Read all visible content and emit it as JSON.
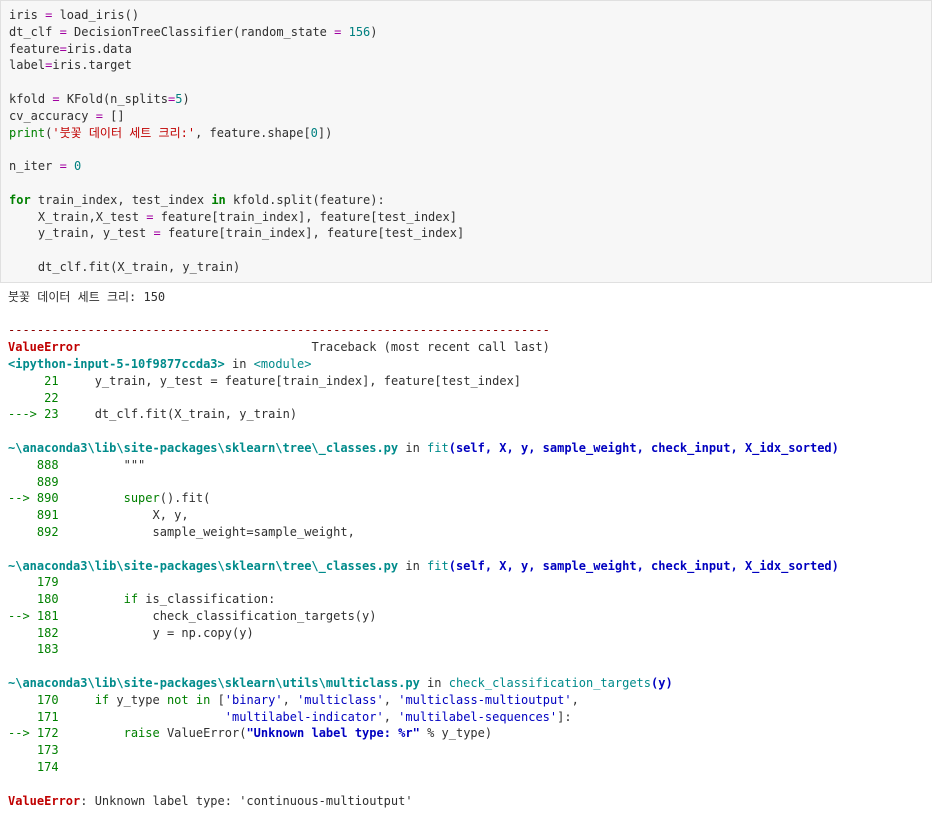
{
  "code": {
    "l1_a": "iris ",
    "l1_b": "=",
    "l1_c": " load_iris()",
    "l2_a": "dt_clf ",
    "l2_b": "=",
    "l2_c": " DecisionTreeClassifier(random_state ",
    "l2_d": "=",
    "l2_e": " ",
    "l2_f": "156",
    "l2_g": ")",
    "l3_a": "feature",
    "l3_b": "=",
    "l3_c": "iris.data",
    "l4_a": "label",
    "l4_b": "=",
    "l4_c": "iris.target",
    "l5": "",
    "l6_a": "kfold ",
    "l6_b": "=",
    "l6_c": " KFold(n_splits",
    "l6_d": "=",
    "l6_e": "5",
    "l6_f": ")",
    "l7_a": "cv_accuracy ",
    "l7_b": "=",
    "l7_c": " []",
    "l8_a": "print",
    "l8_b": "(",
    "l8_c": "'붓꽃 데이터 세트 크리:'",
    "l8_d": ", feature.shape[",
    "l8_e": "0",
    "l8_f": "])",
    "l9": "",
    "l10_a": "n_iter ",
    "l10_b": "=",
    "l10_c": " ",
    "l10_d": "0",
    "l11": "",
    "l12_a": "for",
    "l12_b": " train_index, test_index ",
    "l12_c": "in",
    "l12_d": " kfold.split(feature):",
    "l13_a": "    X_train,X_test ",
    "l13_b": "=",
    "l13_c": " feature[train_index], feature[test_index]",
    "l14_a": "    y_train, y_test ",
    "l14_b": "=",
    "l14_c": " feature[train_index], feature[test_index]",
    "l15": "",
    "l16": "    dt_clf.fit(X_train, y_train)"
  },
  "out": {
    "print_line": "붓꽃 데이터 세트 크리: 150",
    "blank": "",
    "hr": "---------------------------------------------------------------------------",
    "err_name": "ValueError",
    "err_tb_label": "                                Traceback (most recent call last)",
    "f1_loc_a": "<ipython-input-5-10f9877ccda3>",
    "f1_loc_b": " in ",
    "f1_loc_c": "<module>",
    "f1_l21_num": "     21 ",
    "f1_l21_code_a": "    y_train",
    "f1_l21_code_b": ",",
    "f1_l21_code_c": " y_test ",
    "f1_l21_code_d": "=",
    "f1_l21_code_e": " feature",
    "f1_l21_code_f": "[",
    "f1_l21_code_g": "train_index",
    "f1_l21_code_h": "],",
    "f1_l21_code_i": " feature",
    "f1_l21_code_j": "[",
    "f1_l21_code_k": "test_index",
    "f1_l21_code_l": "]",
    "f1_l22_num": "     22 ",
    "f1_l23_arrow": "---> ",
    "f1_l23_num": "23 ",
    "f1_l23_code_a": "    dt_clf",
    "f1_l23_code_b": ".",
    "f1_l23_code_c": "fit",
    "f1_l23_code_d": "(",
    "f1_l23_code_e": "X_train",
    "f1_l23_code_f": ",",
    "f1_l23_code_g": " y_train",
    "f1_l23_code_h": ")",
    "f2_loc_a": "~\\anaconda3\\lib\\site-packages\\sklearn\\tree\\_classes.py",
    "f2_loc_b": " in ",
    "f2_loc_c": "fit",
    "f2_loc_d": "(self, X, y, sample_weight, check_input, X_idx_sorted)",
    "f2_l888_num": "    888 ",
    "f2_l888_code": "        \"\"\"",
    "f2_l889_num": "    889 ",
    "f2_l890_arrow": "--> ",
    "f2_l890_num": "890 ",
    "f2_l890_code_a": "        super",
    "f2_l890_code_b": "().",
    "f2_l890_code_c": "fit",
    "f2_l890_code_d": "(",
    "f2_l891_num": "    891 ",
    "f2_l891_code_a": "            X",
    "f2_l891_code_b": ",",
    "f2_l891_code_c": " y",
    "f2_l891_code_d": ",",
    "f2_l892_num": "    892 ",
    "f2_l892_code_a": "            sample_weight",
    "f2_l892_code_b": "=",
    "f2_l892_code_c": "sample_weight",
    "f2_l892_code_d": ",",
    "f3_l179_num": "    179 ",
    "f3_l180_num": "    180 ",
    "f3_l180_code_a": "        if",
    "f3_l180_code_b": " is_classification",
    "f3_l180_code_c": ":",
    "f3_l181_arrow": "--> ",
    "f3_l181_num": "181 ",
    "f3_l181_code_a": "            check_classification_targets",
    "f3_l181_code_b": "(",
    "f3_l181_code_c": "y",
    "f3_l181_code_d": ")",
    "f3_l182_num": "    182 ",
    "f3_l182_code_a": "            y ",
    "f3_l182_code_b": "=",
    "f3_l182_code_c": " np",
    "f3_l182_code_d": ".",
    "f3_l182_code_e": "copy",
    "f3_l182_code_f": "(",
    "f3_l182_code_g": "y",
    "f3_l182_code_h": ")",
    "f3_l183_num": "    183 ",
    "f4_loc_a": "~\\anaconda3\\lib\\site-packages\\sklearn\\utils\\multiclass.py",
    "f4_loc_b": " in ",
    "f4_loc_c": "check_classification_targets",
    "f4_loc_d": "(y)",
    "f4_l170_num": "    170 ",
    "f4_l170_code_a": "    if",
    "f4_l170_code_b": " y_type ",
    "f4_l170_code_c": "not",
    "f4_l170_code_d": " ",
    "f4_l170_code_e": "in",
    "f4_l170_code_f": " ",
    "f4_l170_code_g": "[",
    "f4_l170_code_h": "'binary'",
    "f4_l170_code_i": ",",
    "f4_l170_code_j": " ",
    "f4_l170_code_k": "'multiclass'",
    "f4_l170_code_l": ",",
    "f4_l170_code_m": " ",
    "f4_l170_code_n": "'multiclass-multioutput'",
    "f4_l170_code_o": ",",
    "f4_l171_num": "    171 ",
    "f4_l171_code_a": "                      ",
    "f4_l171_code_b": "'multilabel-indicator'",
    "f4_l171_code_c": ",",
    "f4_l171_code_d": " ",
    "f4_l171_code_e": "'multilabel-sequences'",
    "f4_l171_code_f": "]:",
    "f4_l172_arrow": "--> ",
    "f4_l172_num": "172 ",
    "f4_l172_code_a": "        raise",
    "f4_l172_code_b": " ValueError",
    "f4_l172_code_c": "(",
    "f4_l172_code_d": "\"Unknown label type: %r\"",
    "f4_l172_code_e": " ",
    "f4_l172_code_f": "%",
    "f4_l172_code_g": " y_type",
    "f4_l172_code_h": ")",
    "f4_l173_num": "    173 ",
    "f4_l174_num": "    174 ",
    "final_err_name": "ValueError",
    "final_err_msg": ": Unknown label type: 'continuous-multioutput'"
  }
}
